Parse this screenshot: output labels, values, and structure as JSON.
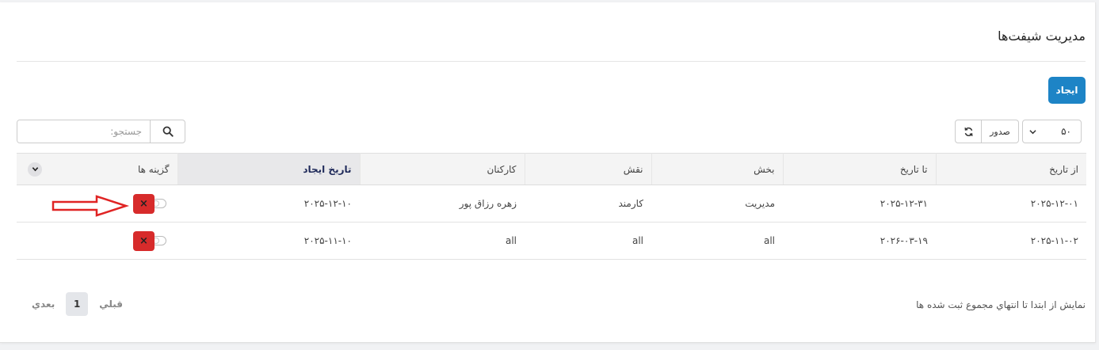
{
  "page": {
    "title": "مدیریت شیفت‌ها",
    "create_label": "ایجاد"
  },
  "toolbar": {
    "page_size": "۵۰",
    "export_label": "صدور",
    "search_placeholder": "جستجو:"
  },
  "table": {
    "columns": [
      "از تاریخ",
      "تا تاریخ",
      "بخش",
      "نقش",
      "کارکنان",
      "تاریخ ایجاد",
      "گزینه ها"
    ],
    "sorted_column": "تاریخ ایجاد",
    "rows": [
      {
        "from_date": "۲۰۲۵-۱۲-۰۱",
        "to_date": "۲۰۲۵-۱۲-۳۱",
        "department": "مدیریت",
        "role": "کارمند",
        "staff": "زهره رزاق پور",
        "created": "۲۰۲۵-۱۲-۱۰",
        "delete_label": "×"
      },
      {
        "from_date": "۲۰۲۵-۱۱-۰۲",
        "to_date": "۲۰۲۶-۰۳-۱۹",
        "department": "all",
        "role": "all",
        "staff": "all",
        "created": "۲۰۲۵-۱۱-۱۰",
        "delete_label": "×"
      }
    ]
  },
  "footer": {
    "info": "نمایش از ابتدا تا انتهاي مجموع ثبت شده ها",
    "prev_label": "قبلي",
    "current_page": "1",
    "next_label": "بعدي"
  },
  "colors": {
    "primary": "#1d84c6",
    "danger": "#d72b2b",
    "annotation_arrow": "#e02424"
  },
  "icons": {
    "search": "search-icon",
    "refresh": "refresh-icon",
    "dropdown": "chevron-down-icon",
    "delete": "close-icon"
  }
}
